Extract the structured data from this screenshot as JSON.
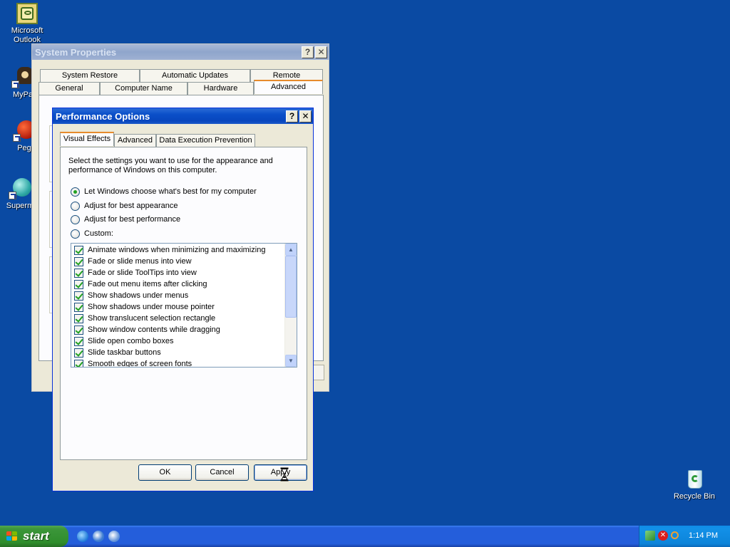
{
  "desktop": {
    "icons": [
      {
        "label": "Microsoft Outlook"
      },
      {
        "label": "MyPa"
      },
      {
        "label": "Peg"
      },
      {
        "label": "Superm"
      },
      {
        "label": "Recycle Bin"
      }
    ]
  },
  "system_properties": {
    "title": "System Properties",
    "help_button": "?",
    "close_button": "✕",
    "tabs_row1": [
      "System Restore",
      "Automatic Updates",
      "Remote"
    ],
    "tabs_row2": [
      "General",
      "Computer Name",
      "Hardware",
      "Advanced"
    ],
    "selected_tab": "Advanced"
  },
  "performance_options": {
    "title": "Performance Options",
    "help_button": "?",
    "close_button": "✕",
    "tabs": [
      "Visual Effects",
      "Advanced",
      "Data Execution Prevention"
    ],
    "selected_tab": "Visual Effects",
    "intro": "Select the settings you want to use for the appearance and performance of Windows on this computer.",
    "radios": [
      {
        "label": "Let Windows choose what's best for my computer",
        "checked": true
      },
      {
        "label": "Adjust for best appearance",
        "checked": false
      },
      {
        "label": "Adjust for best performance",
        "checked": false
      },
      {
        "label": "Custom:",
        "checked": false
      }
    ],
    "effects": [
      {
        "label": "Animate windows when minimizing and maximizing",
        "checked": true
      },
      {
        "label": "Fade or slide menus into view",
        "checked": true
      },
      {
        "label": "Fade or slide ToolTips into view",
        "checked": true
      },
      {
        "label": "Fade out menu items after clicking",
        "checked": true
      },
      {
        "label": "Show shadows under menus",
        "checked": true
      },
      {
        "label": "Show shadows under mouse pointer",
        "checked": true
      },
      {
        "label": "Show translucent selection rectangle",
        "checked": true
      },
      {
        "label": "Show window contents while dragging",
        "checked": true
      },
      {
        "label": "Slide open combo boxes",
        "checked": true
      },
      {
        "label": "Slide taskbar buttons",
        "checked": true
      },
      {
        "label": "Smooth edges of screen fonts",
        "checked": true
      }
    ],
    "scroll_up": "▲",
    "scroll_down": "▼",
    "buttons": {
      "ok": "OK",
      "cancel": "Cancel",
      "apply": "Apply"
    }
  },
  "taskbar": {
    "start_label": "start",
    "clock": "1:14 PM"
  }
}
